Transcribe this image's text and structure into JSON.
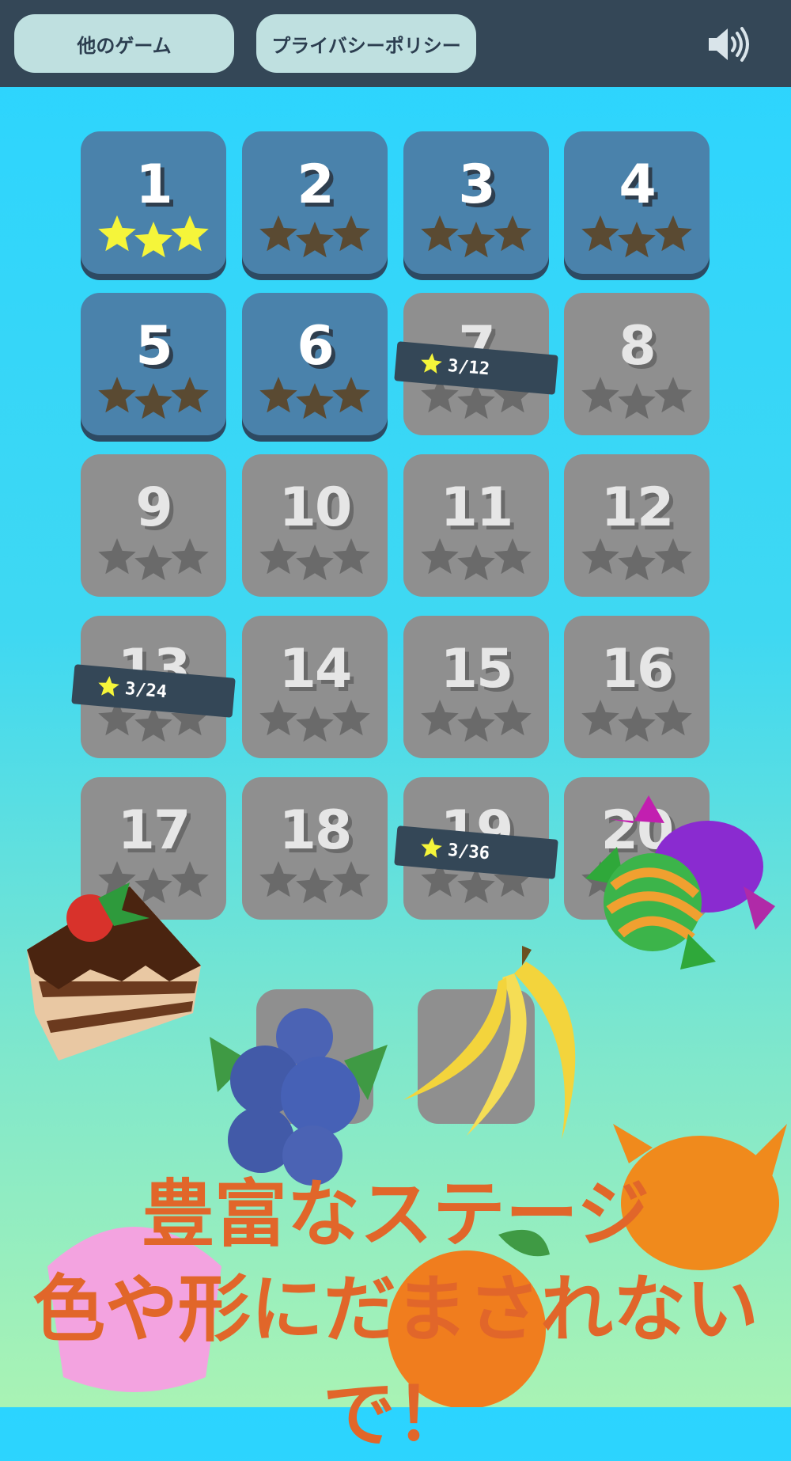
{
  "header": {
    "other_games_label": "他のゲーム",
    "privacy_label": "プライバシーポリシー",
    "sound_icon": "speaker-volume-icon"
  },
  "levels": [
    {
      "number": "1",
      "state": "unlocked",
      "earned": 3
    },
    {
      "number": "2",
      "state": "unlocked",
      "earned": 0
    },
    {
      "number": "3",
      "state": "unlocked",
      "earned": 0
    },
    {
      "number": "4",
      "state": "unlocked",
      "earned": 0
    },
    {
      "number": "5",
      "state": "unlocked",
      "earned": 0
    },
    {
      "number": "6",
      "state": "unlocked",
      "earned": 0
    },
    {
      "number": "7",
      "state": "locked",
      "earned": 0
    },
    {
      "number": "8",
      "state": "locked",
      "earned": 0
    },
    {
      "number": "9",
      "state": "locked",
      "earned": 0
    },
    {
      "number": "10",
      "state": "locked",
      "earned": 0
    },
    {
      "number": "11",
      "state": "locked",
      "earned": 0
    },
    {
      "number": "12",
      "state": "locked",
      "earned": 0
    },
    {
      "number": "13",
      "state": "locked",
      "earned": 0
    },
    {
      "number": "14",
      "state": "locked",
      "earned": 0
    },
    {
      "number": "15",
      "state": "locked",
      "earned": 0
    },
    {
      "number": "16",
      "state": "locked",
      "earned": 0
    },
    {
      "number": "17",
      "state": "locked",
      "earned": 0
    },
    {
      "number": "18",
      "state": "locked",
      "earned": 0
    },
    {
      "number": "19",
      "state": "locked",
      "earned": 0
    },
    {
      "number": "20",
      "state": "locked",
      "earned": 0
    }
  ],
  "requirements": [
    {
      "level": "7",
      "text": "3/12"
    },
    {
      "level": "13",
      "text": "3/24"
    },
    {
      "level": "19",
      "text": "3/36"
    }
  ],
  "slogan": {
    "line1": "豊富なステージ",
    "line2": "色や形にだまされないで！"
  },
  "colors": {
    "unlocked_tile": "#4a82ab",
    "locked_tile": "#8f8f8f",
    "star_gold": "#f5f53a",
    "star_empty_unlocked": "#5a4a32",
    "star_empty_locked": "#6a6a6a",
    "slogan": "#e1662a",
    "topbar": "#344757"
  }
}
